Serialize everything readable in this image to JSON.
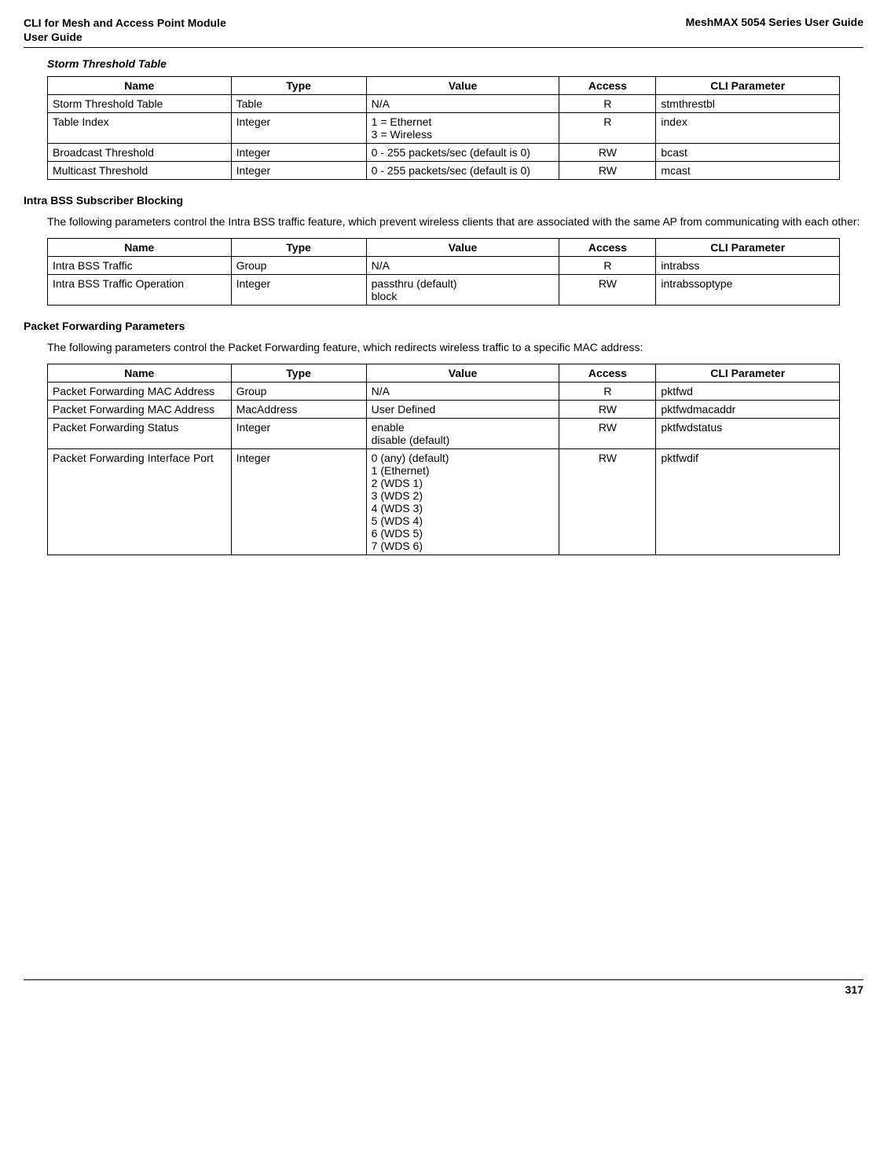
{
  "header": {
    "left_line1": "CLI for Mesh and Access Point Module",
    "left_line2": " User Guide",
    "right": "MeshMAX 5054 Series User Guide"
  },
  "section1": {
    "title": "Storm Threshold Table",
    "columns": [
      "Name",
      "Type",
      "Value",
      "Access",
      "CLI Parameter"
    ],
    "rows": [
      {
        "name": "Storm Threshold Table",
        "type": "Table",
        "value": "N/A",
        "access": "R",
        "cli": "stmthrestbl"
      },
      {
        "name": "Table Index",
        "type": "Integer",
        "value": "1 = Ethernet\n3 = Wireless",
        "access": "R",
        "cli": "index"
      },
      {
        "name": "Broadcast Threshold",
        "type": "Integer",
        "value": "0 - 255 packets/sec (default is 0)",
        "access": "RW",
        "cli": "bcast"
      },
      {
        "name": "Multicast Threshold",
        "type": "Integer",
        "value": "0 - 255 packets/sec (default is 0)",
        "access": "RW",
        "cli": "mcast"
      }
    ]
  },
  "section2": {
    "title": "Intra BSS Subscriber Blocking",
    "text": "The following parameters control the Intra BSS traffic feature, which prevent wireless clients that are associated with the same AP from communicating with each other:",
    "columns": [
      "Name",
      "Type",
      "Value",
      "Access",
      "CLI Parameter"
    ],
    "rows": [
      {
        "name": "Intra BSS Traffic",
        "type": "Group",
        "value": "N/A",
        "access": "R",
        "cli": "intrabss"
      },
      {
        "name": "Intra BSS Traffic Operation",
        "type": "Integer",
        "value": "passthru (default)\nblock",
        "access": "RW",
        "cli": "intrabssoptype"
      }
    ]
  },
  "section3": {
    "title": "Packet Forwarding Parameters",
    "text": "The following parameters control the Packet Forwarding feature, which redirects wireless traffic to a specific MAC address:",
    "columns": [
      "Name",
      "Type",
      "Value",
      "Access",
      "CLI Parameter"
    ],
    "rows": [
      {
        "name": "Packet Forwarding MAC Address",
        "type": "Group",
        "value": "N/A",
        "access": "R",
        "cli": "pktfwd"
      },
      {
        "name": "Packet Forwarding MAC Address",
        "type": "MacAddress",
        "value": "User Defined",
        "access": "RW",
        "cli": "pktfwdmacaddr"
      },
      {
        "name": "Packet Forwarding Status",
        "type": "Integer",
        "value": "enable\ndisable (default)",
        "access": "RW",
        "cli": "pktfwdstatus"
      },
      {
        "name": "Packet Forwarding Interface Port",
        "type": "Integer",
        "value": "0 (any) (default)\n1 (Ethernet)\n2 (WDS 1)\n3 (WDS 2)\n4 (WDS 3)\n5 (WDS 4)\n6 (WDS 5)\n7 (WDS 6)",
        "access": "RW",
        "cli": "pktfwdif"
      }
    ]
  },
  "page_number": "317"
}
